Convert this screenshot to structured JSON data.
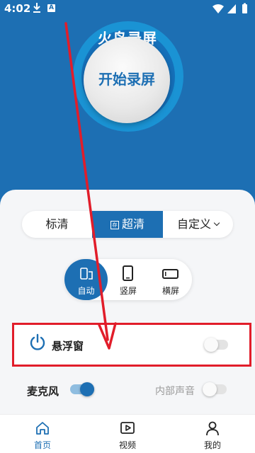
{
  "status_bar": {
    "time": "4:02",
    "notification_a": "A"
  },
  "app": {
    "title": "火鸟录屏"
  },
  "record": {
    "label": "开始录屏"
  },
  "quality": {
    "options": [
      "标清",
      "超清",
      "自定义"
    ],
    "selected": "超清",
    "hd_icon_text": "存"
  },
  "orientation": {
    "options": [
      "自动",
      "竖屏",
      "横屏"
    ],
    "selected": "自动"
  },
  "floating_window": {
    "label": "悬浮窗",
    "enabled": false
  },
  "audio": {
    "mic_label": "麦克风",
    "mic_enabled": true,
    "internal_label": "内部声音",
    "internal_enabled": false
  },
  "bottom_nav": {
    "items": [
      "首页",
      "视频",
      "我的"
    ],
    "active": "首页"
  },
  "colors": {
    "brand": "#1d6fb3",
    "annotation": "#e11d2a"
  }
}
